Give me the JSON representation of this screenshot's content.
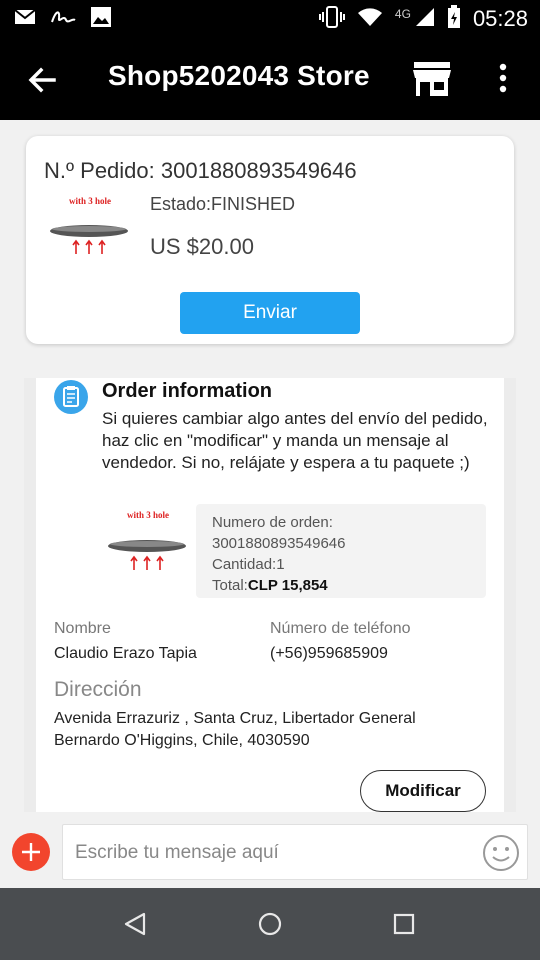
{
  "status_bar": {
    "time": "05:28",
    "network": "4G",
    "left_icons": [
      "mail-icon",
      "signature-icon",
      "image-icon"
    ],
    "right_icons": [
      "vibrate-icon",
      "wifi-icon",
      "signal-icon",
      "battery-icon"
    ]
  },
  "app_bar": {
    "title": "Shop5202043 Store",
    "icons": [
      "back-arrow-icon",
      "store-icon",
      "more-vert-icon"
    ]
  },
  "order_card": {
    "order_number": "N.º Pedido: 3001880893549646",
    "product_image_label": "with 3 hole",
    "status": "Estado:FINISHED",
    "price": "US $20.00",
    "send_button": "Enviar"
  },
  "order_info": {
    "title": "Order information",
    "description": "Si quieres cambiar algo antes del envío del pedido, haz clic en \"modificar\" y manda un mensaje al vendedor. Si no, relájate y espera a tu paquete ;)",
    "product_image_label": "with 3 hole",
    "order_number_label": "Numero de orden:",
    "order_number_value": "3001880893549646",
    "quantity": "Cantidad:1",
    "total_label": "Total:",
    "total_value": "CLP 15,854",
    "name_label": "Nombre",
    "name_value": "Claudio Erazo Tapia",
    "phone_label": "Número de teléfono",
    "phone_value": "(+56)959685909",
    "address_label": "Dirección",
    "address_value": "Avenida Errazuriz , Santa Cruz, Libertador General Bernardo O'Higgins, Chile, 4030590",
    "modify_button": "Modificar"
  },
  "message_bar": {
    "placeholder": "Escribe tu mensaje aquí",
    "icons": [
      "add-icon",
      "emoji-icon"
    ]
  },
  "nav_bar": {
    "icons": [
      "back-triangle-icon",
      "home-circle-icon",
      "recents-square-icon"
    ]
  },
  "colors": {
    "accent_blue": "#22a2f0",
    "add_red": "#f2452d",
    "app_bar": "#000000",
    "nav_bar": "#4a4d50"
  }
}
